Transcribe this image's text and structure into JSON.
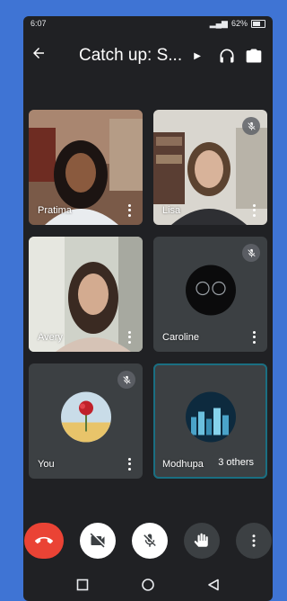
{
  "status_bar": {
    "time": "6:07",
    "battery": "62%"
  },
  "header": {
    "title": "Catch up: S..."
  },
  "participants": [
    {
      "name": "Pratima",
      "muted": false
    },
    {
      "name": "Lisa",
      "muted": true
    },
    {
      "name": "Avery",
      "muted": false
    },
    {
      "name": "Caroline",
      "muted": true
    },
    {
      "name": "You",
      "muted": true
    },
    {
      "name": "Modhupa"
    }
  ],
  "others_badge": "3 others",
  "colors": {
    "end_call": "#ea4335",
    "tile_bg": "#3c4043",
    "screen_bg": "#202124",
    "selected_outline": "#1a6f82"
  }
}
